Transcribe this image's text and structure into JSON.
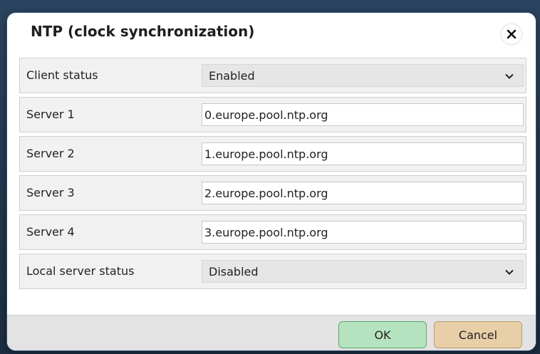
{
  "dialog": {
    "title": "NTP (clock synchronization)",
    "close_icon": "close-icon"
  },
  "rows": [
    {
      "label": "Client status",
      "type": "select",
      "value": "Enabled"
    },
    {
      "label": "Server 1",
      "type": "input",
      "value": "0.europe.pool.ntp.org"
    },
    {
      "label": "Server 2",
      "type": "input",
      "value": "1.europe.pool.ntp.org"
    },
    {
      "label": "Server 3",
      "type": "input",
      "value": "2.europe.pool.ntp.org"
    },
    {
      "label": "Server 4",
      "type": "input",
      "value": "3.europe.pool.ntp.org"
    },
    {
      "label": "Local server status",
      "type": "select",
      "value": "Disabled"
    }
  ],
  "footer": {
    "ok_label": "OK",
    "cancel_label": "Cancel"
  },
  "colors": {
    "ok_bg": "#b6e3bf",
    "ok_border": "#5aa96a",
    "cancel_bg": "#e9cfa8",
    "cancel_border": "#b89a6a"
  }
}
